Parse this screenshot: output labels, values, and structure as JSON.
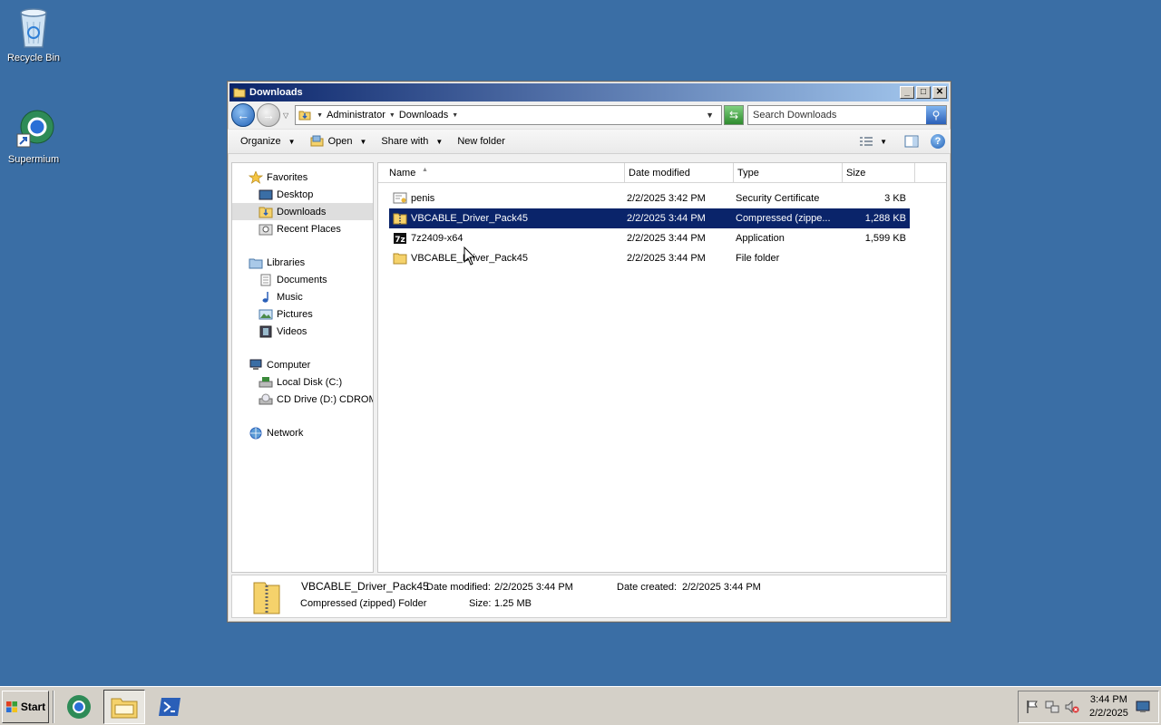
{
  "desktop": {
    "icons": [
      {
        "label": "Recycle Bin",
        "icon": "recycle-bin-icon"
      },
      {
        "label": "Supermium",
        "icon": "supermium-icon"
      }
    ]
  },
  "window": {
    "title": "Downloads",
    "address": {
      "crumbs": [
        "Administrator",
        "Downloads"
      ]
    },
    "search": {
      "placeholder": "Search Downloads"
    },
    "toolbar": {
      "organize": "Organize",
      "open": "Open",
      "share_with": "Share with",
      "new_folder": "New folder"
    },
    "nav": {
      "favorites": {
        "label": "Favorites",
        "items": [
          "Desktop",
          "Downloads",
          "Recent Places"
        ]
      },
      "libraries": {
        "label": "Libraries",
        "items": [
          "Documents",
          "Music",
          "Pictures",
          "Videos"
        ]
      },
      "computer": {
        "label": "Computer",
        "items": [
          "Local Disk (C:)",
          "CD Drive (D:) CDROM"
        ]
      },
      "network": {
        "label": "Network"
      }
    },
    "columns": [
      "Name",
      "Date modified",
      "Type",
      "Size"
    ],
    "files": [
      {
        "name": "penis",
        "date": "2/2/2025 3:42 PM",
        "type": "Security Certificate",
        "size": "3 KB",
        "icon": "certificate-icon"
      },
      {
        "name": "VBCABLE_Driver_Pack45",
        "date": "2/2/2025 3:44 PM",
        "type": "Compressed (zippe...",
        "size": "1,288 KB",
        "icon": "zip-folder-icon",
        "selected": true
      },
      {
        "name": "7z2409-x64",
        "date": "2/2/2025 3:44 PM",
        "type": "Application",
        "size": "1,599 KB",
        "icon": "7zip-icon"
      },
      {
        "name": "VBCABLE_Driver_Pack45",
        "date": "2/2/2025 3:44 PM",
        "type": "File folder",
        "size": "",
        "icon": "folder-icon"
      }
    ],
    "details": {
      "name": "VBCABLE_Driver_Pack45",
      "type": "Compressed (zipped) Folder",
      "modified_label": "Date modified:",
      "modified": "2/2/2025 3:44 PM",
      "created_label": "Date created:",
      "created": "2/2/2025 3:44 PM",
      "size_label": "Size:",
      "size": "1.25 MB"
    }
  },
  "taskbar": {
    "start": "Start",
    "apps": [
      "supermium-icon",
      "explorer-icon",
      "powershell-icon"
    ],
    "clock": {
      "time": "3:44 PM",
      "date": "2/2/2025"
    }
  }
}
